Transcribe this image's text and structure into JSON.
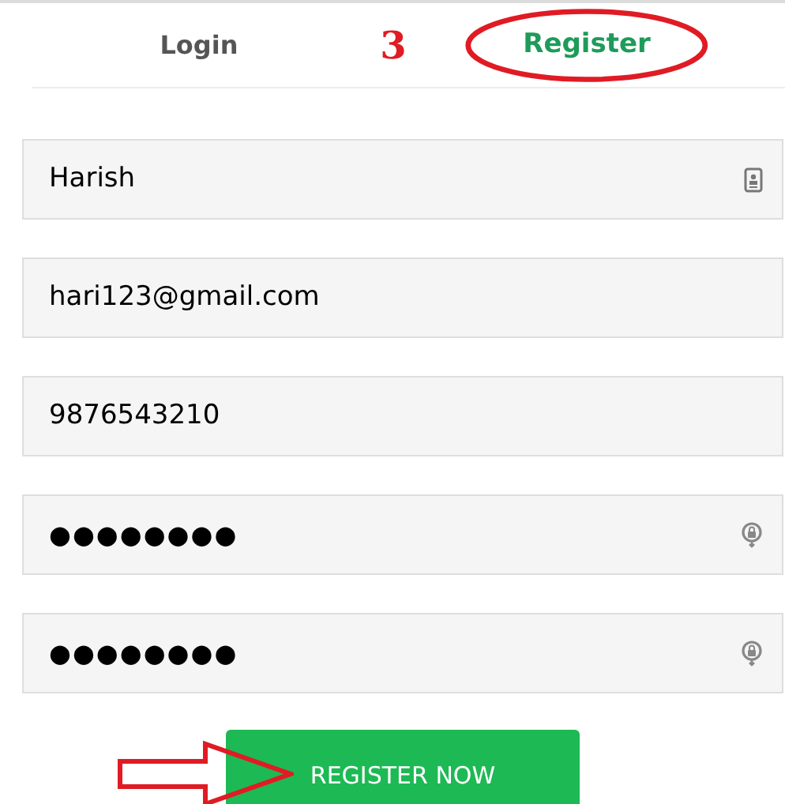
{
  "tabs": [
    {
      "label": "Login",
      "selected": false
    },
    {
      "label": "Register",
      "selected": true
    }
  ],
  "step_marker": "3",
  "fields": [
    {
      "kind": "name",
      "value": "Harish"
    },
    {
      "kind": "email",
      "value": "hari123@gmail.com"
    },
    {
      "kind": "phone",
      "value": "9876543210"
    },
    {
      "kind": "password",
      "value": "●●●●●●●●"
    },
    {
      "kind": "password",
      "value": "●●●●●●●●"
    }
  ],
  "submit_button": "REGISTER NOW"
}
